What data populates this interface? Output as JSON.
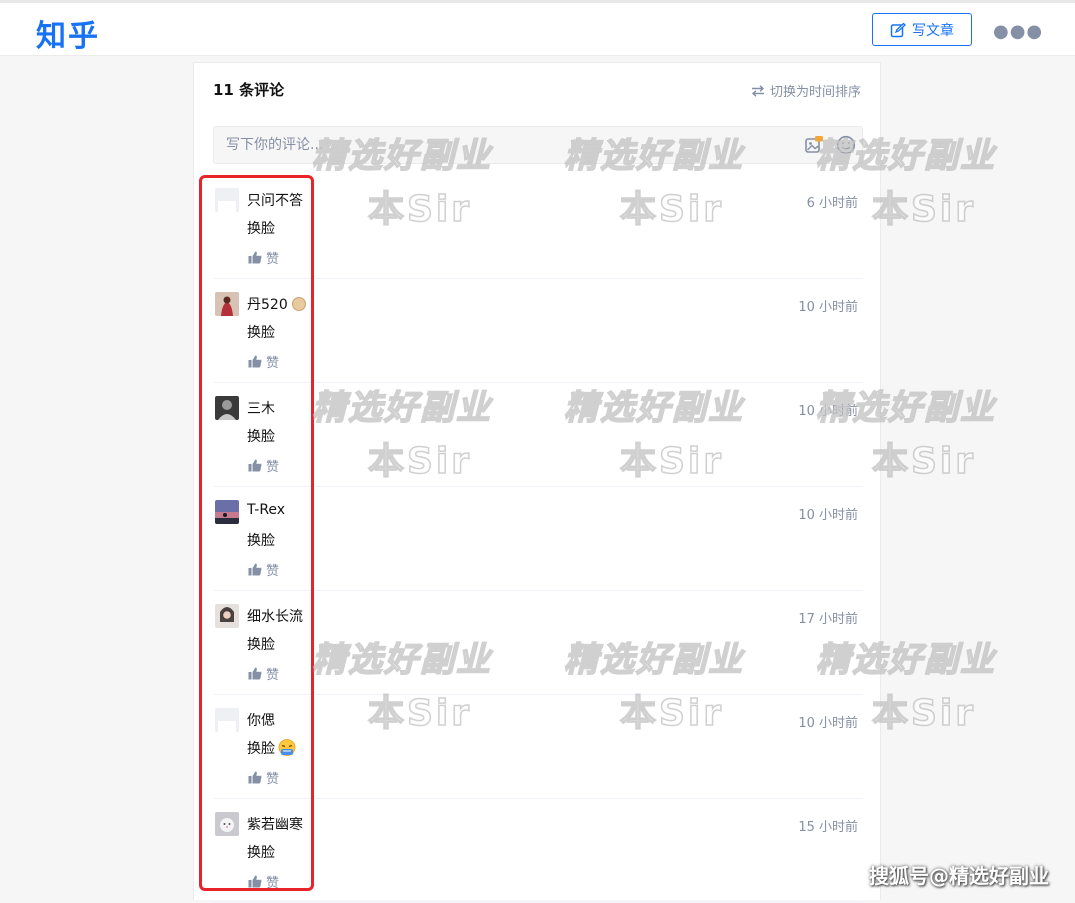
{
  "header": {
    "logo": "知乎",
    "write_label": "写文章"
  },
  "comments_panel": {
    "title": "11 条评论",
    "sort_label": "切换为时间排序",
    "input_placeholder": "写下你的评论..."
  },
  "comments": [
    {
      "author": "只问不答",
      "content": "换脸",
      "time": "6 小时前",
      "like_label": "赞",
      "avatar": "default-avatar"
    },
    {
      "author": "丹520",
      "content": "换脸",
      "time": "10 小时前",
      "like_label": "赞",
      "avatar": "photo-avatar"
    },
    {
      "author": "三木",
      "content": "换脸",
      "time": "10 小时前",
      "like_label": "赞",
      "avatar": "photo-avatar"
    },
    {
      "author": "T-Rex",
      "content": "换脸",
      "time": "10 小时前",
      "like_label": "赞",
      "avatar": "photo-avatar"
    },
    {
      "author": "细水长流",
      "content": "换脸",
      "time": "17 小时前",
      "like_label": "赞",
      "avatar": "photo-avatar"
    },
    {
      "author": "你偲",
      "content": "换脸",
      "time": "10 小时前",
      "like_label": "赞",
      "avatar": "default-avatar"
    },
    {
      "author": "紫若幽寒",
      "content": "换脸",
      "time": "15 小时前",
      "like_label": "赞",
      "avatar": "photo-avatar"
    }
  ],
  "watermarks": {
    "line1": "精选好副业",
    "line2": "本Sir",
    "footer": "搜狐号@精选好副业"
  },
  "colors": {
    "brand": "#1772f6",
    "highlight_box": "#e8232a",
    "muted_text": "#8590a6"
  }
}
